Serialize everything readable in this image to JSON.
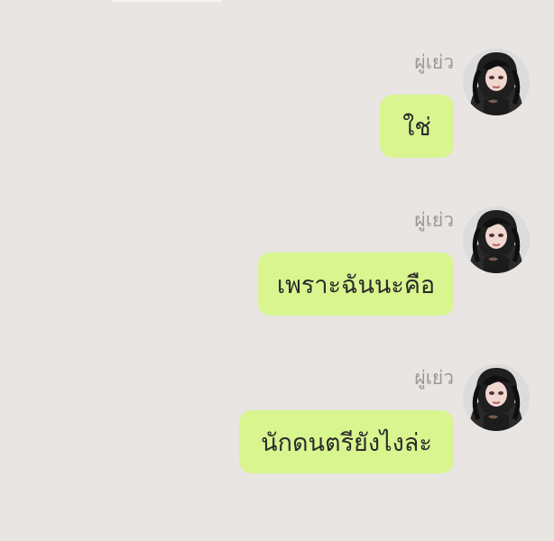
{
  "chat": {
    "messages": [
      {
        "sender": "ผู่เย่ว",
        "text": "ใช่"
      },
      {
        "sender": "ผู่เย่ว",
        "text": "เพราะฉันนะคือ"
      },
      {
        "sender": "ผู่เย่ว",
        "text": "นักดนตรียังไงล่ะ"
      }
    ]
  }
}
